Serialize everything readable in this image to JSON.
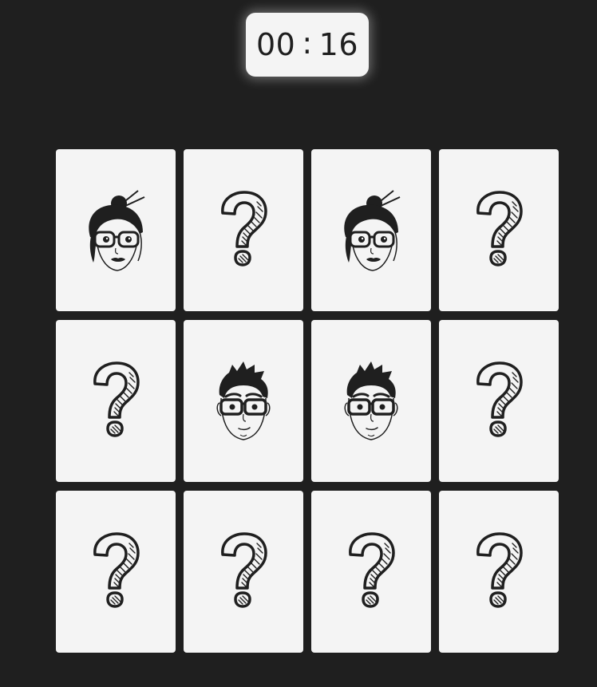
{
  "timer": {
    "minutes": "00",
    "separator": ":",
    "seconds": "16"
  },
  "board": {
    "rows": 3,
    "columns": 4,
    "cards": [
      {
        "state": "revealed",
        "face": "woman-glasses-icon"
      },
      {
        "state": "hidden",
        "face": "question-mark-icon"
      },
      {
        "state": "revealed",
        "face": "woman-glasses-icon"
      },
      {
        "state": "hidden",
        "face": "question-mark-icon"
      },
      {
        "state": "hidden",
        "face": "question-mark-icon"
      },
      {
        "state": "revealed",
        "face": "man-glasses-icon"
      },
      {
        "state": "revealed",
        "face": "man-glasses-icon"
      },
      {
        "state": "hidden",
        "face": "question-mark-icon"
      },
      {
        "state": "hidden",
        "face": "question-mark-icon"
      },
      {
        "state": "hidden",
        "face": "question-mark-icon"
      },
      {
        "state": "hidden",
        "face": "question-mark-icon"
      },
      {
        "state": "hidden",
        "face": "question-mark-icon"
      }
    ]
  },
  "colors": {
    "background": "#1f1f1f",
    "card": "#f4f4f4",
    "ink": "#1f1f1f"
  }
}
